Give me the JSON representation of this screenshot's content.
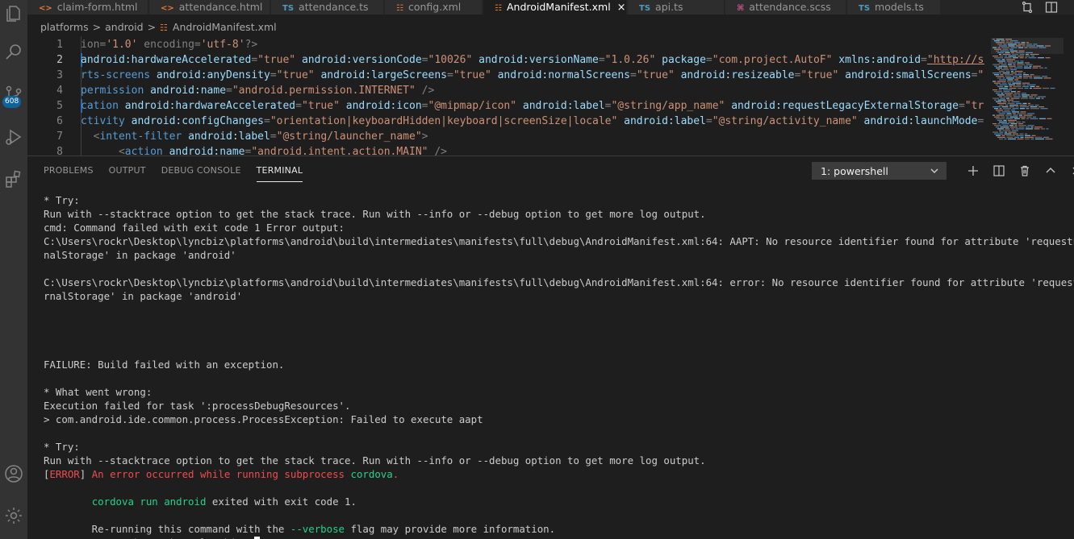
{
  "tabs": [
    {
      "icon": "<>",
      "label": "claim-form.html",
      "active": false
    },
    {
      "icon": "<>",
      "label": "attendance.html",
      "active": false
    },
    {
      "icon": "TS",
      "label": "attendance.ts",
      "active": false
    },
    {
      "icon": "rss",
      "label": "config.xml",
      "active": false
    },
    {
      "icon": "rss",
      "label": "AndroidManifest.xml",
      "active": true
    },
    {
      "icon": "TS",
      "label": "api.ts",
      "active": false
    },
    {
      "icon": "sass",
      "label": "attendance.scss",
      "active": false
    },
    {
      "icon": "TS",
      "label": "models.ts",
      "active": false
    }
  ],
  "tab_close": "×",
  "breadcrumb": [
    "platforms",
    "android",
    "AndroidManifest.xml"
  ],
  "breadcrumb_sep": ">",
  "activity_badge": "608",
  "editor": {
    "line_numbers": [
      "1",
      "2",
      "3",
      "4",
      "5",
      "6",
      "7",
      "8"
    ],
    "lines": [
      [
        [
          "punc",
          "ion="
        ],
        [
          "str",
          "'1.0'"
        ],
        [
          "punc",
          " encoding="
        ],
        [
          "str",
          "'utf-8'"
        ],
        [
          "punc",
          "?>"
        ]
      ],
      [
        [
          "attr",
          "android:hardwareAccelerated"
        ],
        [
          "punc",
          "="
        ],
        [
          "str",
          "\"true\""
        ],
        [
          "punc",
          " "
        ],
        [
          "attr",
          "android:versionCode"
        ],
        [
          "punc",
          "="
        ],
        [
          "str",
          "\"10026\""
        ],
        [
          "punc",
          " "
        ],
        [
          "attr",
          "android:versionName"
        ],
        [
          "punc",
          "="
        ],
        [
          "str",
          "\"1.0.26\""
        ],
        [
          "punc",
          " "
        ],
        [
          "attr",
          "package"
        ],
        [
          "punc",
          "="
        ],
        [
          "str",
          "\"com.project.AutoF\""
        ],
        [
          "punc",
          " "
        ],
        [
          "attr",
          "xmlns:android"
        ],
        [
          "punc",
          "="
        ],
        [
          "url",
          "\"http://sche"
        ]
      ],
      [
        [
          "tag",
          "rts-screens"
        ],
        [
          "punc",
          " "
        ],
        [
          "attr",
          "android:anyDensity"
        ],
        [
          "punc",
          "="
        ],
        [
          "str",
          "\"true\""
        ],
        [
          "punc",
          " "
        ],
        [
          "attr",
          "android:largeScreens"
        ],
        [
          "punc",
          "="
        ],
        [
          "str",
          "\"true\""
        ],
        [
          "punc",
          " "
        ],
        [
          "attr",
          "android:normalScreens"
        ],
        [
          "punc",
          "="
        ],
        [
          "str",
          "\"true\""
        ],
        [
          "punc",
          " "
        ],
        [
          "attr",
          "android:resizeable"
        ],
        [
          "punc",
          "="
        ],
        [
          "str",
          "\"true\""
        ],
        [
          "punc",
          " "
        ],
        [
          "attr",
          "android:smallScreens"
        ],
        [
          "punc",
          "="
        ],
        [
          "str",
          "\"tru"
        ]
      ],
      [
        [
          "tag",
          "permission"
        ],
        [
          "punc",
          " "
        ],
        [
          "attr",
          "android:name"
        ],
        [
          "punc",
          "="
        ],
        [
          "str",
          "\"android.permission.INTERNET\""
        ],
        [
          "punc",
          " />"
        ]
      ],
      [
        [
          "tag",
          "cation"
        ],
        [
          "punc",
          " "
        ],
        [
          "attr",
          "android:hardwareAccelerated"
        ],
        [
          "punc",
          "="
        ],
        [
          "str",
          "\"true\""
        ],
        [
          "punc",
          " "
        ],
        [
          "attr",
          "android:icon"
        ],
        [
          "punc",
          "="
        ],
        [
          "str",
          "\"@mipmap/icon\""
        ],
        [
          "punc",
          " "
        ],
        [
          "attr",
          "android:label"
        ],
        [
          "punc",
          "="
        ],
        [
          "str",
          "\"@string/app_name\""
        ],
        [
          "punc",
          " "
        ],
        [
          "attr",
          "android:requestLegacyExternalStorage"
        ],
        [
          "punc",
          "="
        ],
        [
          "str",
          "\"true\""
        ]
      ],
      [
        [
          "tag",
          "ctivity"
        ],
        [
          "punc",
          " "
        ],
        [
          "attr",
          "android:configChanges"
        ],
        [
          "punc",
          "="
        ],
        [
          "str",
          "\"orientation|keyboardHidden|keyboard|screenSize|locale\""
        ],
        [
          "punc",
          " "
        ],
        [
          "attr",
          "android:label"
        ],
        [
          "punc",
          "="
        ],
        [
          "str",
          "\"@string/activity_name\""
        ],
        [
          "punc",
          " "
        ],
        [
          "attr",
          "android:launchMode"
        ],
        [
          "punc",
          "="
        ],
        [
          "str",
          "\"si"
        ]
      ],
      [
        [
          "punc",
          "  <"
        ],
        [
          "tag",
          "intent-filter"
        ],
        [
          "punc",
          " "
        ],
        [
          "attr",
          "android:label"
        ],
        [
          "punc",
          "="
        ],
        [
          "str",
          "\"@string/launcher_name\""
        ],
        [
          "punc",
          ">"
        ]
      ],
      [
        [
          "punc",
          "      <"
        ],
        [
          "tag",
          "action"
        ],
        [
          "punc",
          " "
        ],
        [
          "attr",
          "android:name"
        ],
        [
          "punc",
          "="
        ],
        [
          "str",
          "\"android.intent.action.MAIN\""
        ],
        [
          "punc",
          " />"
        ]
      ]
    ]
  },
  "panel": {
    "tabs": [
      "PROBLEMS",
      "OUTPUT",
      "DEBUG CONSOLE",
      "TERMINAL"
    ],
    "active_tab": "TERMINAL",
    "terminal_select": "1: powershell"
  },
  "terminal_lines": [
    [
      [
        "",
        "* Try:"
      ]
    ],
    [
      [
        "",
        "Run with --stacktrace option to get the stack trace. Run with --info or --debug option to get more log output."
      ]
    ],
    [
      [
        "",
        "cmd: Command failed with exit code 1 Error output:"
      ]
    ],
    [
      [
        "",
        "C:\\Users\\rockr\\Desktop\\lyncbiz\\platforms\\android\\build\\intermediates\\manifests\\full\\debug\\AndroidManifest.xml:64: AAPT: No resource identifier found for attribute 'requestLegacyExter"
      ]
    ],
    [
      [
        "",
        "nalStorage' in package 'android'"
      ]
    ],
    [
      [
        "",
        ""
      ]
    ],
    [
      [
        "",
        "C:\\Users\\rockr\\Desktop\\lyncbiz\\platforms\\android\\build\\intermediates\\manifests\\full\\debug\\AndroidManifest.xml:64: error: No resource identifier found for attribute 'requestLegacyExte"
      ]
    ],
    [
      [
        "",
        "rnalStorage' in package 'android'"
      ]
    ],
    [
      [
        "",
        ""
      ]
    ],
    [
      [
        "",
        ""
      ]
    ],
    [
      [
        "",
        ""
      ]
    ],
    [
      [
        "",
        ""
      ]
    ],
    [
      [
        "",
        "FAILURE: Build failed with an exception."
      ]
    ],
    [
      [
        "",
        ""
      ]
    ],
    [
      [
        "",
        "* What went wrong:"
      ]
    ],
    [
      [
        "",
        "Execution failed for task ':processDebugResources'."
      ]
    ],
    [
      [
        "",
        "> com.android.ide.common.process.ProcessException: Failed to execute aapt"
      ]
    ],
    [
      [
        "",
        ""
      ]
    ],
    [
      [
        "",
        "* Try:"
      ]
    ],
    [
      [
        "",
        "Run with --stacktrace option to get the stack trace. Run with --info or --debug option to get more log output."
      ]
    ],
    [
      [
        "",
        "["
      ],
      [
        "red",
        "ERROR"
      ],
      [
        "",
        "] "
      ],
      [
        "red",
        "An error occurred while running subprocess "
      ],
      [
        "green",
        "cordova"
      ],
      [
        "red",
        "."
      ]
    ],
    [
      [
        "",
        ""
      ]
    ],
    [
      [
        "",
        "        "
      ],
      [
        "green",
        "cordova run android"
      ],
      [
        "",
        " exited with exit code 1."
      ]
    ],
    [
      [
        "",
        ""
      ]
    ],
    [
      [
        "",
        "        Re-running this command with the "
      ],
      [
        "green",
        "--verbose"
      ],
      [
        "",
        " flag may provide more information."
      ]
    ],
    [
      [
        "",
        "PS C:\\Users\\rockr\\Desktop\\lyncbiz> "
      ]
    ]
  ],
  "colors": {
    "accent": "#0e639c",
    "error_red": "#f14c4c",
    "terminal_green": "#23d18b",
    "xml_tag": "#569cd6",
    "xml_attr": "#9cdcfe",
    "xml_string": "#ce9178"
  }
}
